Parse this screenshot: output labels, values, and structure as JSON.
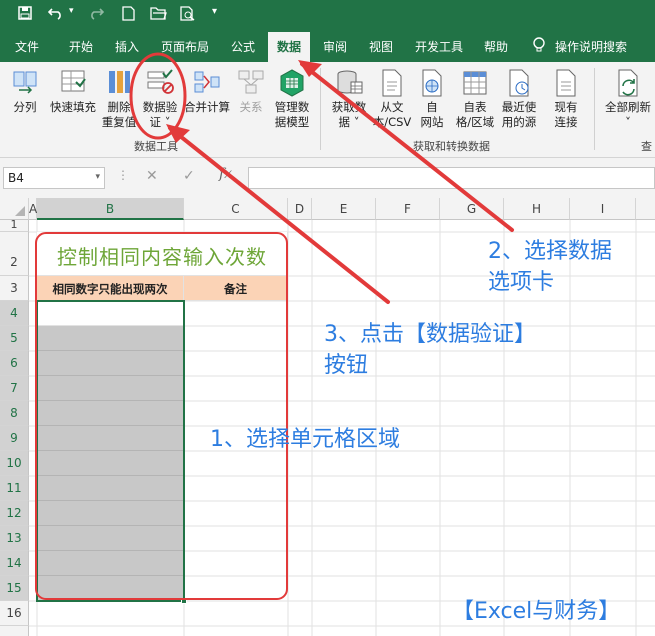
{
  "quick_access": {
    "save": "save-icon",
    "undo": "undo-icon",
    "redo": "redo-icon",
    "new": "new-file-icon",
    "open": "open-folder-icon",
    "print_preview": "print-preview-icon"
  },
  "tabs": [
    "文件",
    "开始",
    "插入",
    "页面布局",
    "公式",
    "数据",
    "审阅",
    "视图",
    "开发工具",
    "帮助",
    "操作说明搜索"
  ],
  "active_tab": "数据",
  "ribbon": {
    "btn_split": "分列",
    "btn_flashfill": "快速填充",
    "btn_dedup_1": "删除",
    "btn_dedup_2": "重复值",
    "btn_validate_1": "数据验",
    "btn_validate_2": "证 ˅",
    "btn_consolidate": "合并计算",
    "btn_relations": "关系",
    "btn_model_1": "管理数",
    "btn_model_2": "据模型",
    "group_datatools": "数据工具",
    "btn_getdata_1": "获取数",
    "btn_getdata_2": "据 ˅",
    "btn_fromtext_1": "从文",
    "btn_fromtext_2": "本/CSV",
    "btn_fromweb_1": "自",
    "btn_fromweb_2": "网站",
    "btn_fromtable_1": "自表",
    "btn_fromtable_2": "格/区域",
    "btn_recent_1": "最近使",
    "btn_recent_2": "用的源",
    "btn_existing_1": "现有",
    "btn_existing_2": "连接",
    "group_getdata": "获取和转换数据",
    "btn_refresh_1": "全部刷新",
    "btn_refresh_2": "˅",
    "group_cut": "查"
  },
  "formula_bar": {
    "name_box": "B4",
    "cancel": "✕",
    "enter": "✓",
    "fx": "fx",
    "formula": ""
  },
  "columns": [
    "A",
    "B",
    "C",
    "D",
    "E",
    "F",
    "G",
    "H",
    "I"
  ],
  "rows": [
    "1",
    "2",
    "3",
    "4",
    "5",
    "6",
    "7",
    "8",
    "9",
    "10",
    "11",
    "12",
    "13",
    "14",
    "15",
    "16"
  ],
  "sheet": {
    "title": "控制相同内容输入次数",
    "header_b": "相同数字只能出现两次",
    "header_c": "备注"
  },
  "annotations": {
    "step1": "1、选择单元格区域",
    "step2_1": "2、选择数据",
    "step2_2": "选项卡",
    "step3_1": "3、点击【数据验证】",
    "step3_2": "按钮"
  },
  "footer": "【Excel与财务】",
  "colors": {
    "excel_green": "#217346",
    "annotation_red": "#e23a3a",
    "annotation_blue": "#2d7de0",
    "header_fill": "#fbd3b6",
    "title_green": "#6ea638"
  }
}
